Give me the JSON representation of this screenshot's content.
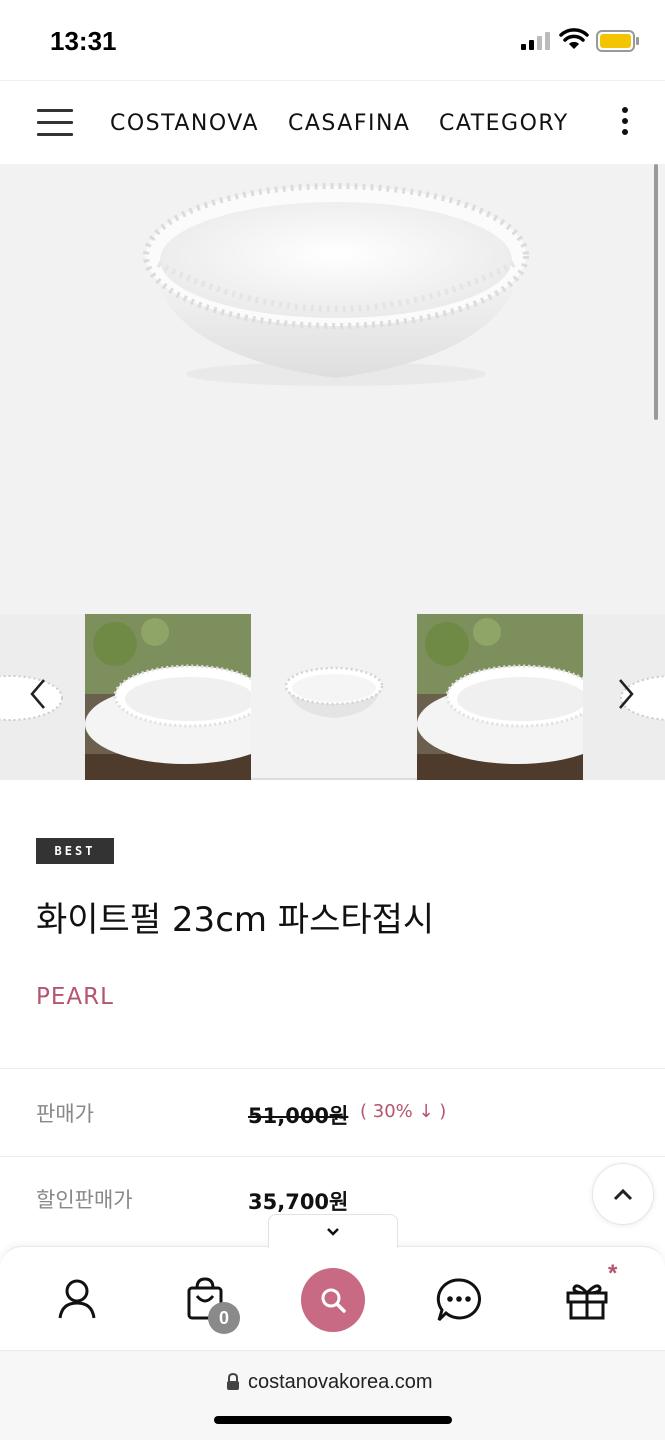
{
  "status_bar": {
    "time": "13:31"
  },
  "nav": {
    "links": [
      "COSTANOVA",
      "CASAFINA",
      "CATEGORY"
    ]
  },
  "product": {
    "badge": "BEST",
    "title": "화이트펄 23cm 파스타접시",
    "collection": "PEARL",
    "price_label": "판매가",
    "original_price": "51,000원",
    "discount": "( 30% ↓ )",
    "sale_label": "할인판매가",
    "sale_price": "35,700원"
  },
  "cart": {
    "count": "0"
  },
  "gift": {
    "marker": "*"
  },
  "browser": {
    "url": "costanovakorea.com"
  },
  "colors": {
    "accent": "#c96a84",
    "brand_text": "#b5546d"
  },
  "icons": [
    "menu-icon",
    "more-icon",
    "chevron-left-icon",
    "chevron-right-icon",
    "chevron-up-icon",
    "chevron-down-icon",
    "user-icon",
    "cart-icon",
    "search-icon",
    "chat-icon",
    "gift-icon",
    "lock-icon"
  ]
}
